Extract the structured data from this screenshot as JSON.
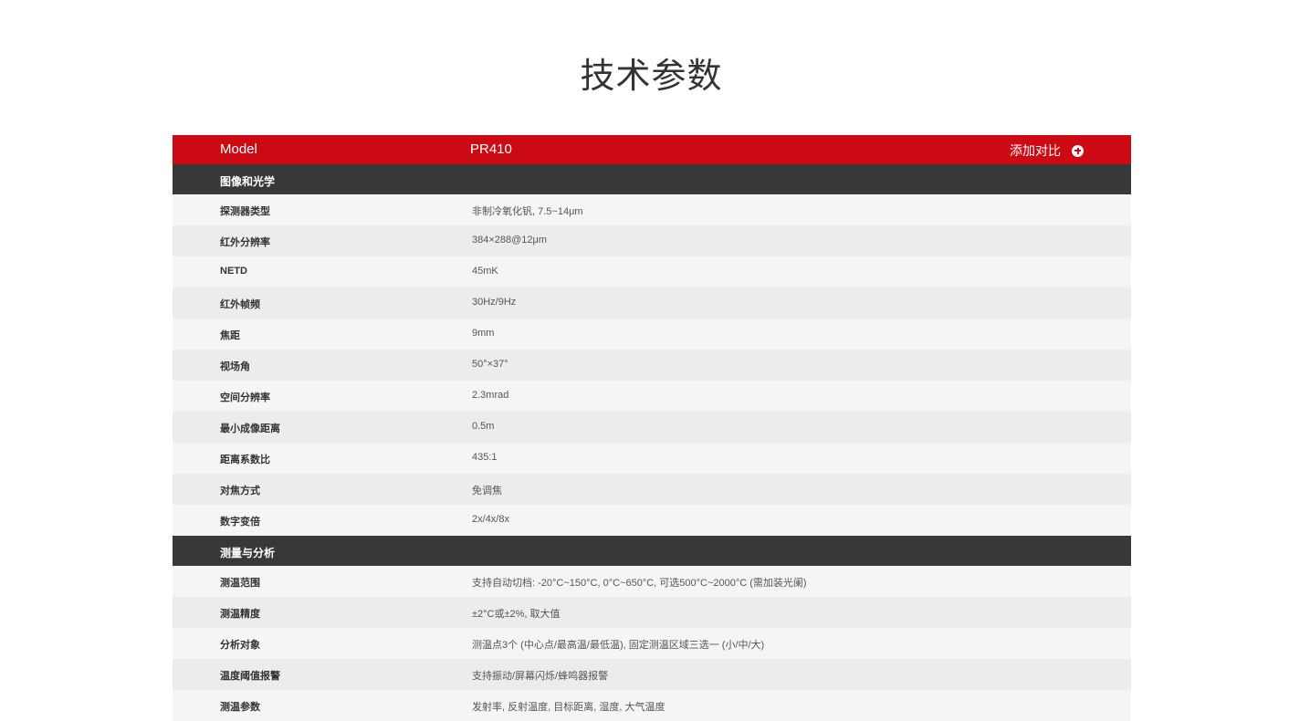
{
  "page": {
    "title": "技术参数"
  },
  "header": {
    "model_label": "Model",
    "model_value": "PR410",
    "compare_label": "添加对比",
    "compare_icon": "plus-circle-icon"
  },
  "colors": {
    "accent_red": "#cc0a14",
    "section_dark": "#383838"
  },
  "sections": [
    {
      "title": "图像和光学",
      "rows": [
        {
          "label": "探测器类型",
          "value": "非制冷氧化钒, 7.5~14μm"
        },
        {
          "label": "红外分辨率",
          "value": "384×288@12μm"
        },
        {
          "label": "NETD",
          "value": "45mK"
        },
        {
          "label": "红外帧频",
          "value": "30Hz/9Hz"
        },
        {
          "label": "焦距",
          "value": "9mm"
        },
        {
          "label": "视场角",
          "value": "50°×37°"
        },
        {
          "label": "空间分辨率",
          "value": "2.3mrad"
        },
        {
          "label": "最小成像距离",
          "value": "0.5m"
        },
        {
          "label": "距离系数比",
          "value": "435:1"
        },
        {
          "label": "对焦方式",
          "value": "免调焦"
        },
        {
          "label": "数字变倍",
          "value": "2x/4x/8x"
        }
      ]
    },
    {
      "title": "测量与分析",
      "rows": [
        {
          "label": "测温范围",
          "value": "支持自动切档: -20°C~150°C, 0°C~650°C, 可选500°C~2000°C (需加装光阑)"
        },
        {
          "label": "测温精度",
          "value": "±2°C或±2%, 取大值"
        },
        {
          "label": "分析对象",
          "value": "测温点3个 (中心点/最高温/最低温), 固定测温区域三选一 (小/中/大)"
        },
        {
          "label": "温度阈值报警",
          "value": "支持振动/屏幕闪烁/蜂鸣器报警"
        },
        {
          "label": "测温参数",
          "value": "发射率, 反射温度, 目标距离, 湿度, 大气温度"
        }
      ]
    }
  ]
}
